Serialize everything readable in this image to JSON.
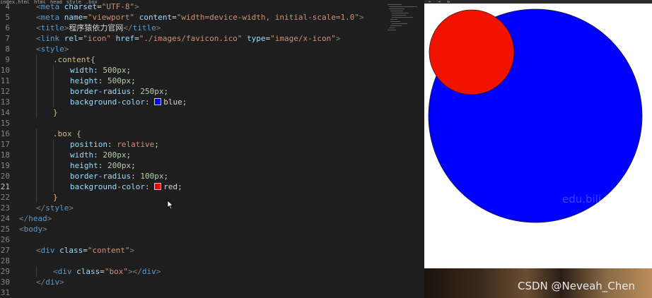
{
  "breadcrumb": [
    "index.html",
    "html",
    "head",
    "style",
    ".box"
  ],
  "code_lines": [
    {
      "no": "4",
      "indent": 1,
      "tokens": [
        [
          "punc",
          "<"
        ],
        [
          "tag",
          "meta "
        ],
        [
          "attr",
          "charset"
        ],
        [
          "txt",
          "="
        ],
        [
          "str",
          "\"UTF-8\""
        ],
        [
          "punc",
          ">"
        ]
      ]
    },
    {
      "no": "5",
      "indent": 1,
      "tokens": [
        [
          "punc",
          "<"
        ],
        [
          "tag",
          "meta "
        ],
        [
          "attr",
          "name"
        ],
        [
          "txt",
          "="
        ],
        [
          "str",
          "\"viewport\" "
        ],
        [
          "attr",
          "content"
        ],
        [
          "txt",
          "="
        ],
        [
          "str",
          "\"width=device-width, initial-scale=1.0\""
        ],
        [
          "punc",
          ">"
        ]
      ]
    },
    {
      "no": "6",
      "indent": 1,
      "tokens": [
        [
          "punc",
          "<"
        ],
        [
          "tag",
          "title"
        ],
        [
          "punc",
          ">"
        ],
        [
          "txt",
          "程序猿依力官网"
        ],
        [
          "punc",
          "</"
        ],
        [
          "tag",
          "title"
        ],
        [
          "punc",
          ">"
        ]
      ]
    },
    {
      "no": "7",
      "indent": 1,
      "tokens": [
        [
          "punc",
          "<"
        ],
        [
          "tag",
          "link "
        ],
        [
          "attr",
          "rel"
        ],
        [
          "txt",
          "="
        ],
        [
          "str",
          "\"icon\" "
        ],
        [
          "attr",
          "href"
        ],
        [
          "txt",
          "="
        ],
        [
          "str",
          "\"./images/favicon.ico\" "
        ],
        [
          "attr",
          "type"
        ],
        [
          "txt",
          "="
        ],
        [
          "str",
          "\"image/x-icon\""
        ],
        [
          "punc",
          ">"
        ]
      ]
    },
    {
      "no": "8",
      "indent": 1,
      "tokens": [
        [
          "punc",
          "<"
        ],
        [
          "tag",
          "style"
        ],
        [
          "punc",
          ">"
        ]
      ]
    },
    {
      "no": "9",
      "indent": 2,
      "tokens": [
        [
          "sel",
          ".content{"
        ]
      ]
    },
    {
      "no": "10",
      "indent": 3,
      "tokens": [
        [
          "prop",
          "width"
        ],
        [
          "txt",
          ": "
        ],
        [
          "num",
          "500px"
        ],
        [
          "txt",
          ";"
        ]
      ]
    },
    {
      "no": "11",
      "indent": 3,
      "tokens": [
        [
          "prop",
          "height"
        ],
        [
          "txt",
          ": "
        ],
        [
          "num",
          "500px"
        ],
        [
          "txt",
          ";"
        ]
      ]
    },
    {
      "no": "12",
      "indent": 3,
      "tokens": [
        [
          "prop",
          "border-radius"
        ],
        [
          "txt",
          ": "
        ],
        [
          "num",
          "250px"
        ],
        [
          "txt",
          ";"
        ]
      ]
    },
    {
      "no": "13",
      "indent": 3,
      "tokens": [
        [
          "prop",
          "background-color"
        ],
        [
          "txt",
          ": "
        ],
        [
          "swatch",
          "#0000ff"
        ],
        [
          "txt",
          "blue;"
        ]
      ]
    },
    {
      "no": "14",
      "indent": 2,
      "tokens": [
        [
          "sel",
          "}"
        ]
      ]
    },
    {
      "no": "15",
      "indent": 0,
      "tokens": []
    },
    {
      "no": "16",
      "indent": 2,
      "tokens": [
        [
          "sel",
          ".box {"
        ]
      ]
    },
    {
      "no": "17",
      "indent": 3,
      "tokens": [
        [
          "prop",
          "position"
        ],
        [
          "txt",
          ": "
        ],
        [
          "val",
          "relative"
        ],
        [
          "txt",
          ";"
        ]
      ]
    },
    {
      "no": "18",
      "indent": 3,
      "tokens": [
        [
          "prop",
          "width"
        ],
        [
          "txt",
          ": "
        ],
        [
          "num",
          "200px"
        ],
        [
          "txt",
          ";"
        ]
      ]
    },
    {
      "no": "19",
      "indent": 3,
      "tokens": [
        [
          "prop",
          "height"
        ],
        [
          "txt",
          ": "
        ],
        [
          "num",
          "200px"
        ],
        [
          "txt",
          ";"
        ]
      ]
    },
    {
      "no": "20",
      "indent": 3,
      "tokens": [
        [
          "prop",
          "border-radius"
        ],
        [
          "txt",
          ": "
        ],
        [
          "num",
          "100px"
        ],
        [
          "txt",
          ";"
        ]
      ]
    },
    {
      "no": "21",
      "indent": 3,
      "active": true,
      "tokens": [
        [
          "prop",
          "background-color"
        ],
        [
          "txt",
          ": "
        ],
        [
          "swatch",
          "#ff0000"
        ],
        [
          "txt",
          "red;"
        ]
      ]
    },
    {
      "no": "22",
      "indent": 2,
      "tokens": [
        [
          "sel",
          "}"
        ]
      ]
    },
    {
      "no": "23",
      "indent": 1,
      "tokens": [
        [
          "punc",
          "</"
        ],
        [
          "tag",
          "style"
        ],
        [
          "punc",
          ">"
        ]
      ]
    },
    {
      "no": "24",
      "indent": 0,
      "tokens": [
        [
          "punc",
          "</"
        ],
        [
          "tag",
          "head"
        ],
        [
          "punc",
          ">"
        ]
      ]
    },
    {
      "no": "25",
      "indent": 0,
      "tokens": [
        [
          "punc",
          "<"
        ],
        [
          "tag",
          "body"
        ],
        [
          "punc",
          ">"
        ]
      ]
    },
    {
      "no": "26",
      "indent": 0,
      "tokens": []
    },
    {
      "no": "27",
      "indent": 1,
      "tokens": [
        [
          "punc",
          "<"
        ],
        [
          "tag",
          "div "
        ],
        [
          "attr",
          "class"
        ],
        [
          "txt",
          "="
        ],
        [
          "str",
          "\"content\""
        ],
        [
          "punc",
          ">"
        ]
      ]
    },
    {
      "no": "28",
      "indent": 0,
      "tokens": []
    },
    {
      "no": "29",
      "indent": 2,
      "tokens": [
        [
          "punc",
          "<"
        ],
        [
          "tag",
          "div "
        ],
        [
          "attr",
          "class"
        ],
        [
          "txt",
          "="
        ],
        [
          "str",
          "\"box\""
        ],
        [
          "punc",
          "></"
        ],
        [
          "tag",
          "div"
        ],
        [
          "punc",
          ">"
        ]
      ]
    },
    {
      "no": "30",
      "indent": 1,
      "tokens": [
        [
          "punc",
          "</"
        ],
        [
          "tag",
          "div"
        ],
        [
          "punc",
          ">"
        ]
      ]
    },
    {
      "no": "31",
      "indent": 0,
      "tokens": []
    }
  ],
  "preview": {
    "content_color": "#0000ff",
    "box_color": "#f21200"
  },
  "watermarks": {
    "overlay": "edu.bili",
    "credit": "CSDN @Neveah_Chen"
  }
}
